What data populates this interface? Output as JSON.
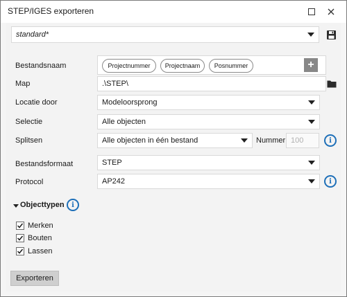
{
  "window": {
    "title": "STEP/IGES exporteren"
  },
  "preset": {
    "value": "standard*"
  },
  "rows": {
    "bestandsnaam": {
      "label": "Bestandsnaam",
      "chips": [
        "Projectnummer",
        "Projectnaam",
        "Posnummer"
      ],
      "add_glyph": "+"
    },
    "map": {
      "label": "Map",
      "value": ".\\STEP\\"
    },
    "locatie": {
      "label": "Locatie door",
      "value": "Modeloorsprong"
    },
    "selectie": {
      "label": "Selectie",
      "value": "Alle objecten"
    },
    "splitsen": {
      "label": "Splitsen",
      "value": "Alle objecten in één bestand",
      "nummer_label": "Nummer",
      "nummer_value": "100"
    },
    "bestandsformaat": {
      "label": "Bestandsformaat",
      "value": "STEP"
    },
    "protocol": {
      "label": "Protocol",
      "value": "AP242"
    }
  },
  "objecttypen": {
    "title": "Objecttypen",
    "items": [
      {
        "label": "Merken",
        "checked": true
      },
      {
        "label": "Bouten",
        "checked": true
      },
      {
        "label": "Lassen",
        "checked": true
      }
    ]
  },
  "export_button": {
    "label": "Exporteren"
  },
  "info_glyph": "i",
  "colors": {
    "accent": "#1d6fb8",
    "border": "#7a7a7a",
    "panel": "#f3f3f3"
  }
}
